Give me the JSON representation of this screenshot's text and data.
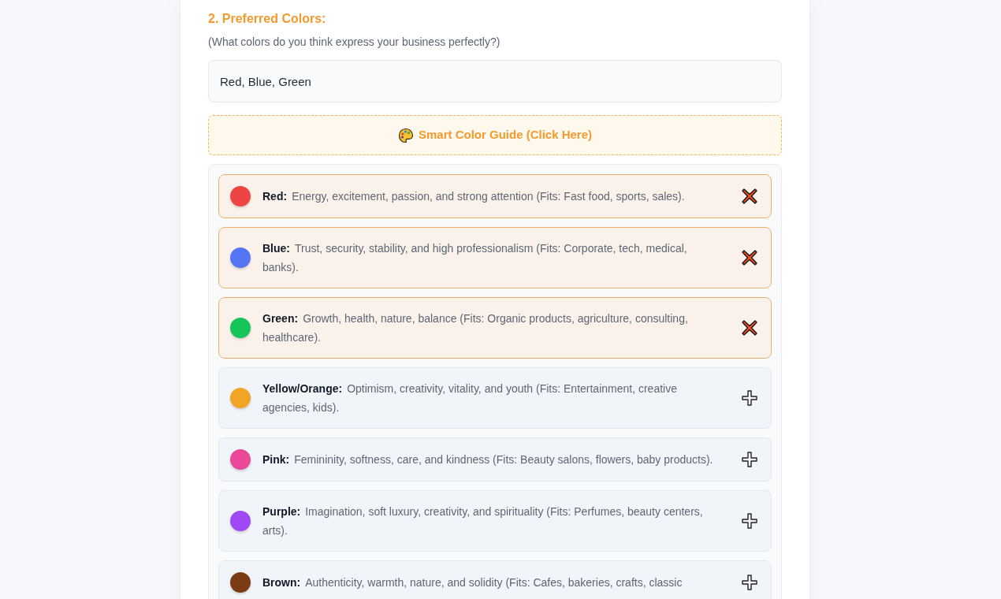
{
  "section": {
    "title": "2. Preferred Colors:",
    "subtitle": "(What colors do you think express your business perfectly?)"
  },
  "colors_field": {
    "value": "Red, Blue, Green"
  },
  "guide_button": {
    "label": "Smart Color Guide (Click Here)"
  },
  "color_options": [
    {
      "name": "Red:",
      "description": "Energy, excitement, passion, and strong attention (Fits: Fast food, sports, sales).",
      "color": "#ef4444",
      "selected": true
    },
    {
      "name": "Blue:",
      "description": "Trust, security, stability, and high professionalism (Fits: Corporate, tech, medical, banks).",
      "color": "#5476f5",
      "selected": true
    },
    {
      "name": "Green:",
      "description": "Growth, health, nature, balance (Fits: Organic products, agriculture, consulting, healthcare).",
      "color": "#16c45a",
      "selected": true
    },
    {
      "name": "Yellow/Orange:",
      "description": "Optimism, creativity, vitality, and youth (Fits: Entertainment, creative agencies, kids).",
      "color": "#f2a424",
      "selected": false
    },
    {
      "name": "Pink:",
      "description": "Femininity, softness, care, and kindness (Fits: Beauty salons, flowers, baby products).",
      "color": "#ec4899",
      "selected": false
    },
    {
      "name": "Purple:",
      "description": "Imagination, soft luxury, creativity, and spirituality (Fits: Perfumes, beauty centers, arts).",
      "color": "#a048f5",
      "selected": false
    },
    {
      "name": "Brown:",
      "description": "Authenticity, warmth, nature, and solidity (Fits: Cafes, bakeries, crafts, classic",
      "color": "#7a3c14",
      "selected": false
    }
  ]
}
